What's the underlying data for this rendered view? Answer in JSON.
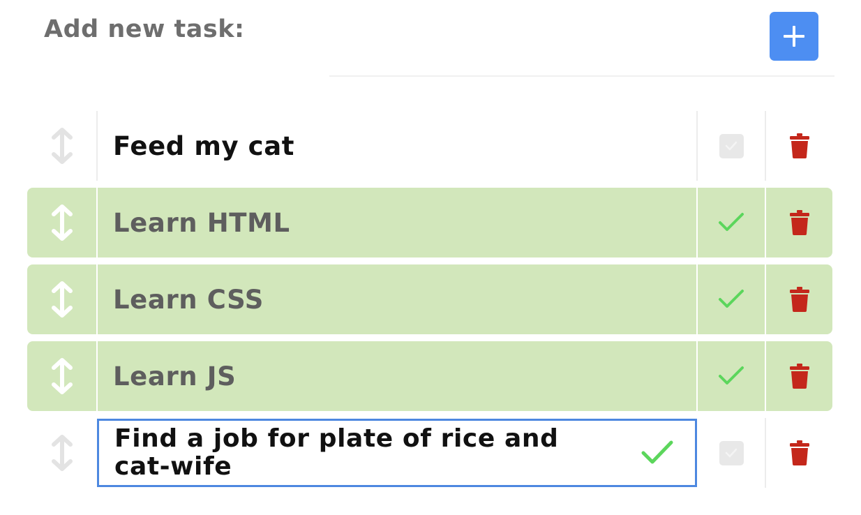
{
  "header": {
    "add_label": "Add new task:",
    "input_value": "",
    "add_button_icon": "plus-icon"
  },
  "colors": {
    "accent": "#4d8ef2",
    "done_bg": "#d2e7bb",
    "check_green": "#5cd65c",
    "delete_red": "#c4271b"
  },
  "tasks": [
    {
      "text": "Feed my cat",
      "done": false
    },
    {
      "text": "Learn HTML",
      "done": true
    },
    {
      "text": "Learn CSS",
      "done": true
    },
    {
      "text": "Learn JS",
      "done": true
    },
    {
      "text": "Find a job for plate of rice and cat-wife",
      "done": false,
      "editing": true
    }
  ]
}
